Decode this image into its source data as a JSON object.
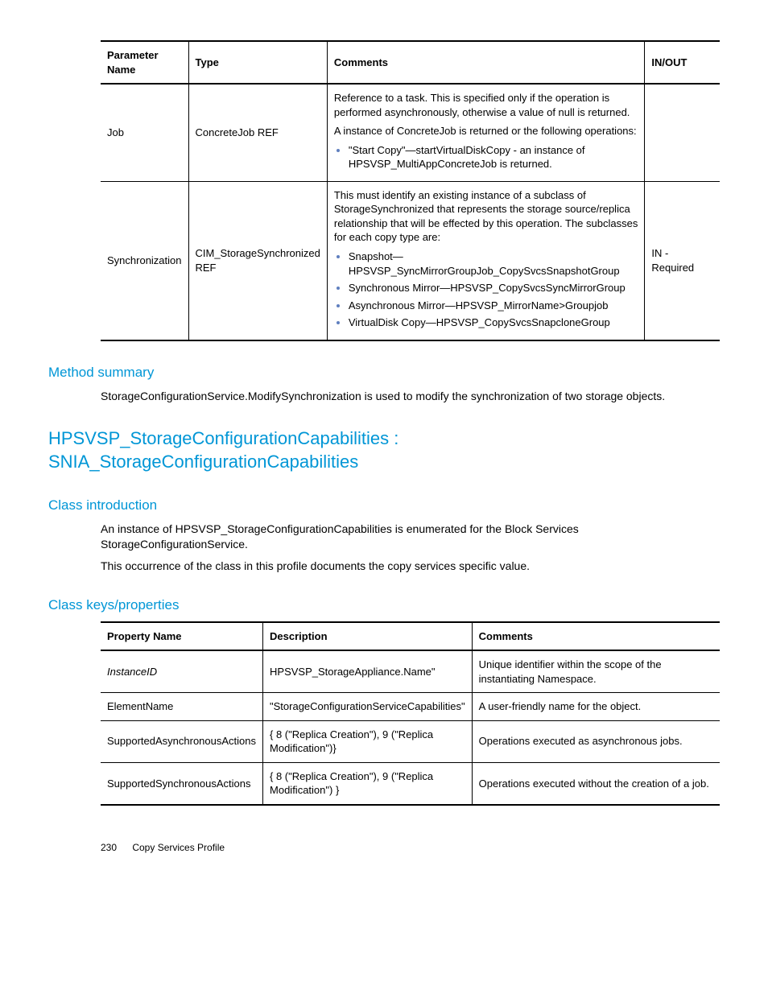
{
  "table1": {
    "headers": [
      "Parameter Name",
      "Type",
      "Comments",
      "IN/OUT"
    ],
    "rows": [
      {
        "name": "Job",
        "type": "ConcreteJob REF",
        "comments_intro1": "Reference to a task. This is specified only if the operation is performed asynchronously, otherwise a value of null is returned.",
        "comments_intro2": "A instance of ConcreteJob is returned or the following operations:",
        "bullets": [
          "\"Start Copy\"—startVirtualDiskCopy - an instance of HPSVSP_MultiAppConcreteJob is returned."
        ],
        "inout": ""
      },
      {
        "name": "Synchronization",
        "type": "CIM_StorageSynchronized REF",
        "comments_intro1": "This must identify an existing instance of a subclass of StorageSynchronized that represents the storage source/replica relationship that will be effected by this operation. The subclasses for each copy type are:",
        "bullets": [
          "Snapshot—HPSVSP_SyncMirrorGroupJob_CopySvcsSnapshotGroup",
          "Synchronous Mirror—HPSVSP_CopySvcsSyncMirrorGroup",
          "Asynchronous Mirror—HPSVSP_MirrorName>Groupjob",
          "VirtualDisk Copy—HPSVSP_CopySvcsSnapcloneGroup"
        ],
        "inout": "IN - Required"
      }
    ]
  },
  "method_summary_heading": "Method summary",
  "method_summary_text": "StorageConfigurationService.ModifySynchronization is used to modify the synchronization of two storage objects.",
  "main_title_line1": "HPSVSP_StorageConfigurationCapabilities :",
  "main_title_line2": "SNIA_StorageConfigurationCapabilities",
  "class_intro_heading": "Class introduction",
  "class_intro_p1": "An instance of HPSVSP_StorageConfigurationCapabilities is enumerated for the Block Services StorageConfigurationService.",
  "class_intro_p2": "This occurrence of the class in this profile documents the copy services specific value.",
  "class_keys_heading": "Class keys/properties",
  "table2": {
    "headers": [
      "Property Name",
      "Description",
      "Comments"
    ],
    "rows": [
      {
        "name": "InstanceID",
        "italic": true,
        "desc": "HPSVSP_StorageAppliance.Name\"",
        "comments": "Unique identifier within the scope of the instantiating Namespace."
      },
      {
        "name": "ElementName",
        "italic": false,
        "desc": "\"StorageConfigurationServiceCapabilities\"",
        "comments": "A user-friendly name for the object."
      },
      {
        "name": "SupportedAsynchronousActions",
        "italic": false,
        "desc": "{ 8 (\"Replica Creation\"), 9 (\"Replica Modification\")}",
        "comments": "Operations executed as asynchronous jobs."
      },
      {
        "name": "SupportedSynchronousActions",
        "italic": false,
        "desc": "{ 8 (\"Replica Creation\"), 9 (\"Replica Modification\") }",
        "comments": "Operations executed without the creation of a job."
      }
    ]
  },
  "footer_page": "230",
  "footer_text": "Copy Services Profile"
}
